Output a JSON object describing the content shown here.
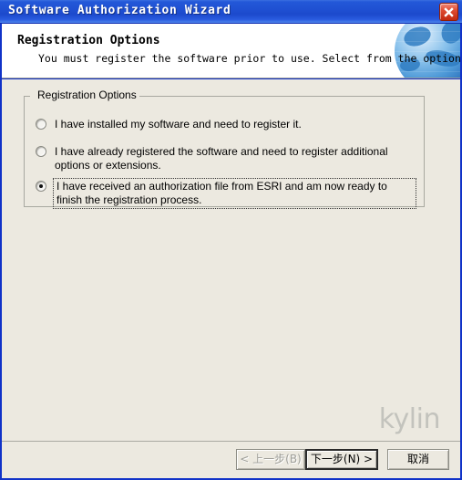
{
  "window": {
    "title": "Software Authorization Wizard",
    "close_icon": "close-icon"
  },
  "header": {
    "title": "Registration Options",
    "subtitle": "You must register the software prior to use. Select from the options below.",
    "graphic": "globe-icon"
  },
  "groupbox": {
    "title": "Registration Options",
    "options": [
      {
        "label": "I have installed my software and need to register it.",
        "selected": false,
        "focused": false
      },
      {
        "label": "I have already registered the software and need to register additional options or extensions.",
        "selected": false,
        "focused": false
      },
      {
        "label": "I have received an authorization file from ESRI and am now ready to finish the registration process.",
        "selected": true,
        "focused": true
      }
    ]
  },
  "watermark": {
    "text": "kylin"
  },
  "footer": {
    "back_label": "< 上一步(B)",
    "next_label": "下一步(N) >",
    "cancel_label": "取消"
  },
  "colors": {
    "titlebar_blue": "#1f50d2",
    "window_border": "#1032c8",
    "body_gray": "#ece9e0",
    "close_red": "#c22a10",
    "watermark_gray": "#c3c3bd"
  }
}
